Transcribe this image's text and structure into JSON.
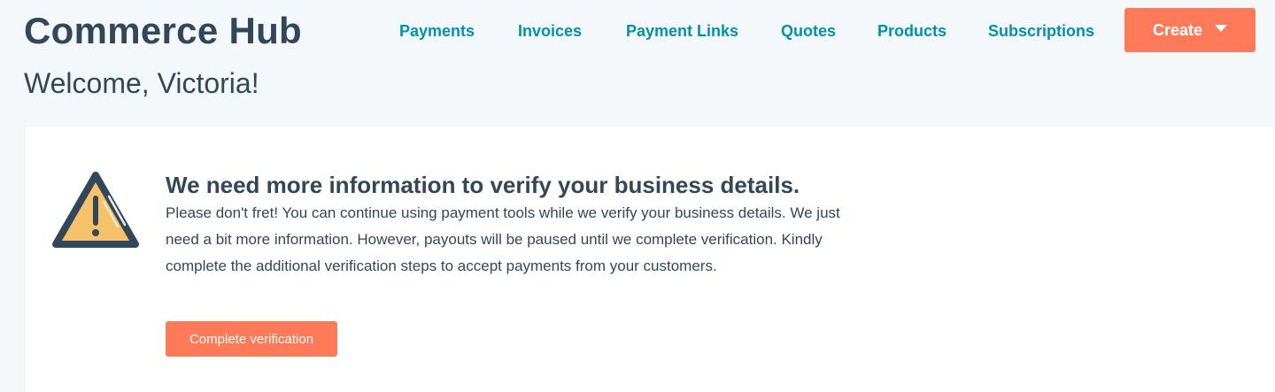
{
  "header": {
    "app_title": "Commerce Hub",
    "nav": [
      {
        "label": "Payments"
      },
      {
        "label": "Invoices"
      },
      {
        "label": "Payment Links"
      },
      {
        "label": "Quotes"
      },
      {
        "label": "Products"
      },
      {
        "label": "Subscriptions"
      }
    ],
    "create_label": "Create"
  },
  "welcome": "Welcome, Victoria!",
  "alert": {
    "icon": "warning-icon",
    "title": "We need more information to verify your business details.",
    "body": "Please don't fret! You can continue using payment tools while we verify your business details. We just need a bit more information. However, payouts will be paused until we complete verification. Kindly complete the additional verification steps to accept payments from your customers.",
    "button_label": "Complete verification"
  },
  "colors": {
    "accent": "#ff7a59",
    "link": "#0091ae",
    "text": "#33475b",
    "background": "#f5f8fa",
    "warning_fill": "#f5c26b"
  }
}
